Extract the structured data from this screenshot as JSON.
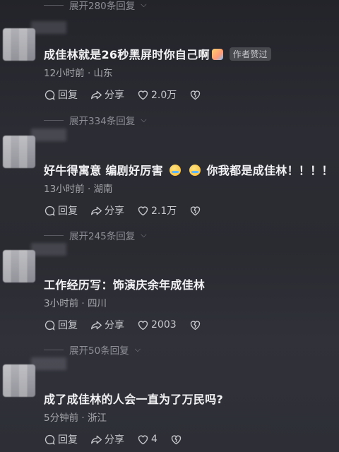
{
  "expand_rows": [
    {
      "label": "展开280条回复"
    },
    {
      "label": "展开334条回复"
    },
    {
      "label": "展开245条回复"
    },
    {
      "label": "展开50条回复"
    }
  ],
  "comments": [
    {
      "text": "成佳林就是26秒黑屏时你自己啊",
      "badge": "作者赞过",
      "meta": "12小时前 · 山东",
      "reply_label": "回复",
      "share_label": "分享",
      "like_count": "2.0万"
    },
    {
      "text_a": "好牛得寓意 编剧好厉害",
      "text_b": "你我都是成佳林！！！！",
      "meta": "13小时前 · 湖南",
      "reply_label": "回复",
      "share_label": "分享",
      "like_count": "2.1万"
    },
    {
      "text": "工作经历写：饰演庆余年成佳林",
      "meta": "3小时前 · 四川",
      "reply_label": "回复",
      "share_label": "分享",
      "like_count": "2003"
    },
    {
      "text": "成了成佳林的人会一直为了万民吗?",
      "meta": "5分钟前 · 浙江",
      "reply_label": "回复",
      "share_label": "分享",
      "like_count": "4"
    }
  ],
  "icons": {
    "reply": "reply-icon",
    "share": "share-icon",
    "like": "heart-icon",
    "dislike": "broken-heart-icon",
    "expand": "chevron-down-icon"
  }
}
